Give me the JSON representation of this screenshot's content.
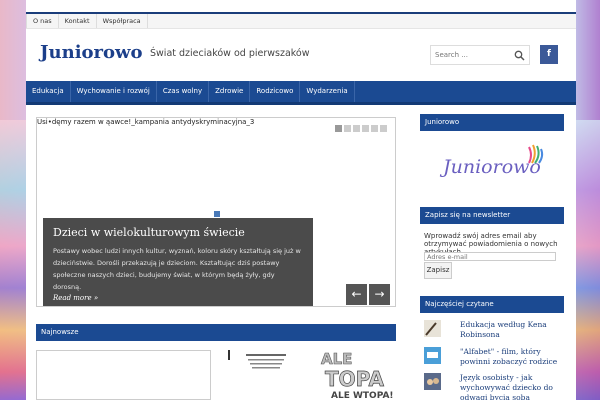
{
  "topbar": {
    "links": [
      "O nas",
      "Kontakt",
      "Współpraca"
    ]
  },
  "header": {
    "site_title": "Juniorowo",
    "tagline": "Świat dzieciaków od pierwszaków",
    "search_placeholder": "Search ...",
    "facebook_label": "f"
  },
  "nav": {
    "items": [
      "Edukacja",
      "Wychowanie i rozwój",
      "Czas wolny",
      "Zdrowie",
      "Rodzicowo",
      "Wydarzenia"
    ]
  },
  "slider": {
    "image_alt": "Usi•dęmy razem w ąawce!_kampania antydyskryminacyjna_3",
    "title": "Dzieci w wielokulturowym świecie",
    "excerpt": "Postawy wobec ludzi innych kultur, wyznań, koloru skóry kształtują się już w dzieciństwie. Dorośli przekazują je dzieciom. Kształtując dziś postawy społeczne naszych dzieci, budujemy świat, w którym będą żyły, gdy dorosną.",
    "read_more": "Read more »",
    "prev": "←",
    "next": "→"
  },
  "sections": {
    "newest": "Najnowsze"
  },
  "sidebar": {
    "logo_title": "Juniorowo",
    "logo_text": "Juniorowo",
    "newsletter_title": "Zapisz się na newsletter",
    "newsletter_text": "Wprowadź swój adres email aby otrzymywać powiadomienia o nowych artykułach.",
    "newsletter_placeholder": "Adres e-mail",
    "newsletter_button": "Zapisz",
    "popular_title": "Najczęściej czytane",
    "popular": [
      "Edukacja według Kena Robinsona",
      "\"Alfabet\" - film, który powinni zobaczyć rodzice",
      "Język osobisty - jak wychowywać dziecko do odwagi bycia sobą"
    ]
  },
  "colors": {
    "accent": "#1b4a92",
    "title": "#1c3f8a",
    "facebook": "#3b5998"
  }
}
